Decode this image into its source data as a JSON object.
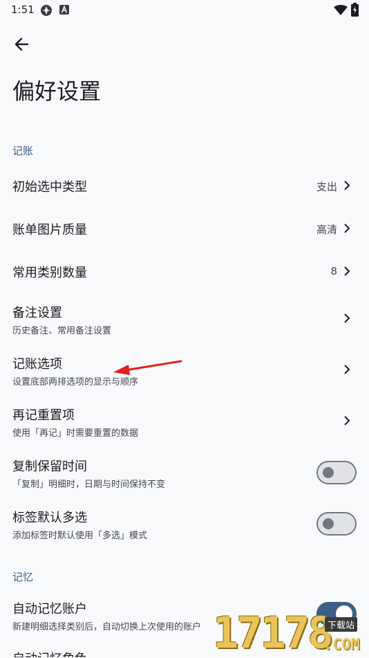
{
  "status_bar": {
    "time": "1:51",
    "icons": [
      "app-icon-1",
      "app-icon-a",
      "wifi-icon",
      "battery-charging-icon"
    ]
  },
  "header": {
    "back_icon": "arrow-back-icon",
    "title": "偏好设置"
  },
  "sections": {
    "bookkeeping": {
      "header": "记账",
      "rows": {
        "initial_type": {
          "title": "初始选中类型",
          "value": "支出"
        },
        "image_quality": {
          "title": "账单图片质量",
          "value": "高清"
        },
        "category_count": {
          "title": "常用类别数量",
          "value": "8"
        },
        "note_settings": {
          "title": "备注设置",
          "subtitle": "历史备注、常用备注设置"
        },
        "options": {
          "title": "记账选项",
          "subtitle": "设置底部两排选项的显示与顺序"
        },
        "reset_items": {
          "title": "再记重置项",
          "subtitle": "使用「再记」时需要重置的数据"
        },
        "copy_retain_time": {
          "title": "复制保留时间",
          "subtitle": "「复制」明细时，日期与时间保持不变",
          "checked": false
        },
        "tag_multi_select": {
          "title": "标签默认多选",
          "subtitle": "添加标签时默认使用「多选」模式",
          "checked": false
        }
      }
    },
    "memory": {
      "header": "记忆",
      "rows": {
        "auto_account": {
          "title": "自动记忆账户",
          "subtitle": "新建明细选择类别后，自动切换上次使用的账户",
          "checked": true
        },
        "auto_role": {
          "title": "自动记忆角色"
        }
      }
    }
  },
  "watermark": {
    "number": "17178",
    "badge": "下载站",
    "domain": ".COM"
  },
  "colors": {
    "accent": "#3f5f86",
    "background": "#f8f9fb",
    "annotation_arrow": "#e02020",
    "watermark": "#e8c45a"
  }
}
